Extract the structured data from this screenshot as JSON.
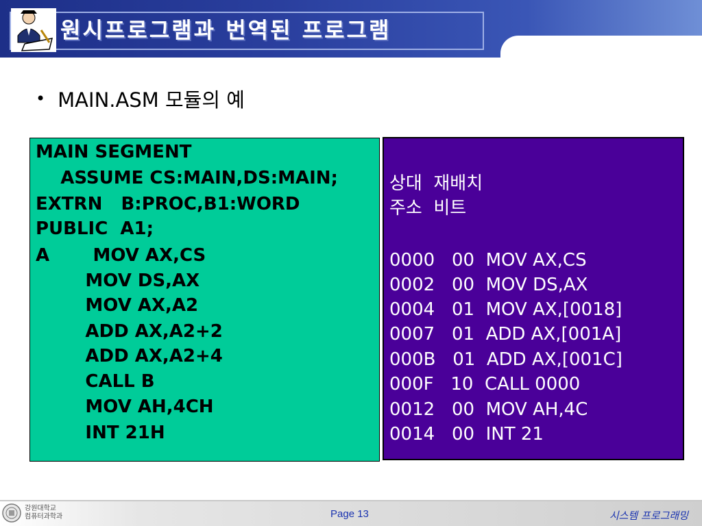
{
  "header": {
    "title": "원시프로그램과 번역된 프로그램"
  },
  "bullet": {
    "text": "MAIN.ASM 모듈의 예"
  },
  "source_code": {
    "lines": [
      "MAIN SEGMENT",
      "    ASSUME CS:MAIN,DS:MAIN;",
      "EXTRN   B:PROC,B1:WORD",
      "PUBLIC  A1;",
      "A       MOV AX,CS",
      "        MOV DS,AX",
      "        MOV AX,A2",
      "        ADD AX,A2+2",
      "        ADD AX,A2+4",
      "        CALL B",
      "        MOV AH,4CH",
      "        INT 21H"
    ]
  },
  "output": {
    "header_line1": "상대  재배치",
    "header_line2": "주소  비트",
    "lines": [
      "0000   00  MOV AX,CS",
      "0002   00  MOV DS,AX",
      "0004   01  MOV AX,[0018]",
      "0007   01  ADD AX,[001A]",
      "000B   01  ADD AX,[001C]",
      "000F   10  CALL 0000",
      "0012   00  MOV AH,4C",
      "0014   00  INT 21"
    ]
  },
  "footer": {
    "univ_line1": "강원대학교",
    "univ_line2": "컴퓨터과학과",
    "page": "Page 13",
    "course": "시스템 프로그래밍"
  },
  "colors": {
    "code_panel_bg": "#00cc99",
    "output_panel_bg": "#4a0099",
    "header_bg": "#2a3f9e",
    "footer_text": "#1a33b0"
  }
}
